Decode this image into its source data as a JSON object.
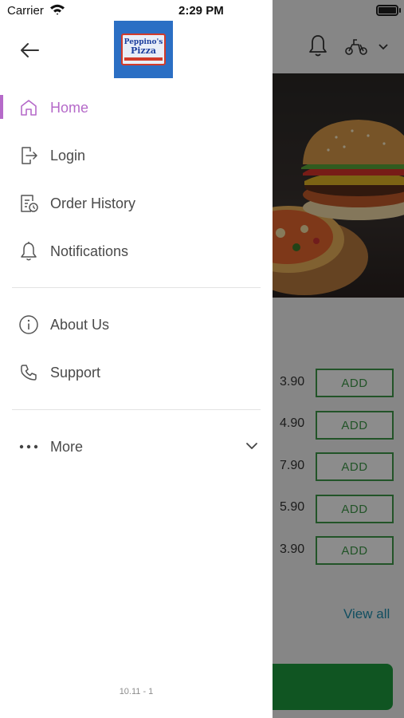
{
  "status_bar": {
    "carrier": "Carrier",
    "time": "2:29 PM"
  },
  "drawer": {
    "logo": {
      "line1": "Peppino's",
      "line2": "Pizza"
    },
    "menu": [
      {
        "label": "Home",
        "icon": "home-icon",
        "active": true
      },
      {
        "label": "Login",
        "icon": "login-icon"
      },
      {
        "label": "Order History",
        "icon": "order-history-icon"
      },
      {
        "label": "Notifications",
        "icon": "bell-icon"
      },
      {
        "label": "About Us",
        "icon": "info-icon"
      },
      {
        "label": "Support",
        "icon": "phone-icon"
      },
      {
        "label": "More",
        "icon": "more-dots-icon"
      }
    ],
    "version": "10.11 - 1",
    "accent_color": "#b56ac9"
  },
  "background": {
    "products": [
      {
        "price": "3.90",
        "button": "ADD"
      },
      {
        "price": "4.90",
        "button": "ADD"
      },
      {
        "price": "7.90",
        "button": "ADD"
      },
      {
        "price": "5.90",
        "button": "ADD"
      },
      {
        "price": "3.90",
        "button": "ADD"
      }
    ],
    "view_all": "View all",
    "accent_green": "#3f9a4a"
  }
}
